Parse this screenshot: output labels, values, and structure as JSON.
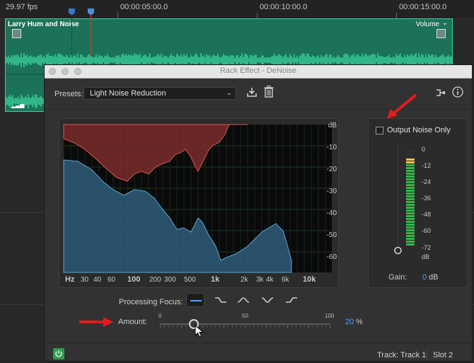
{
  "timeline": {
    "fps": "29.97 fps",
    "timecodes": [
      "00:00:05:00.0",
      "00:00:10:00.0",
      "00:00:15:00.0"
    ],
    "clip_title": "Larry Hum and Noise",
    "clip_volume_label": "Volume"
  },
  "window": {
    "title": "Rack Effect - DeNoise"
  },
  "presets": {
    "label": "Presets:",
    "selected": "Light Noise Reduction"
  },
  "spectrum": {
    "db_labels": [
      "dB",
      "-10",
      "-20",
      "-30",
      "-40",
      "-50",
      "-60"
    ],
    "hz_labels": [
      "Hz",
      "30",
      "40",
      "60",
      "100",
      "200",
      "300",
      "500",
      "1k",
      "2k",
      "3k",
      "4k",
      "6k",
      "10k"
    ]
  },
  "output": {
    "label": "Output Noise Only",
    "checked": false
  },
  "meter": {
    "labels": [
      "0",
      "-12",
      "-24",
      "-36",
      "-48",
      "-60",
      "-72",
      "dB"
    ]
  },
  "gain": {
    "label": "Gain:",
    "value": "0",
    "unit": "dB"
  },
  "processing_focus": {
    "label": "Processing Focus:"
  },
  "amount": {
    "label": "Amount:",
    "ticks": [
      "0",
      "50",
      "100"
    ],
    "value": "20",
    "unit": "%",
    "fraction": 0.2
  },
  "footer": {
    "track": "Track: Track 1",
    "slot": "Slot 2"
  },
  "colors": {
    "clip_green": "#1c7259",
    "wave_green": "#3bd3a0",
    "accent_blue": "#4fa3ff",
    "arrow_red": "#e31b1b",
    "power_green": "#2f9e4e"
  }
}
